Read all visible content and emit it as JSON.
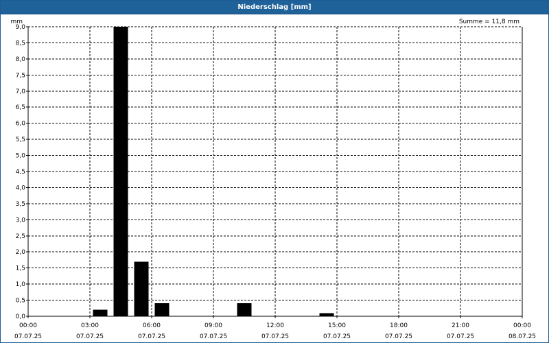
{
  "window": {
    "title": "Niederschlag [mm]"
  },
  "chart_data": {
    "type": "bar",
    "title": "Niederschlag [mm]",
    "ylabel": "mm",
    "xlabel": "",
    "ylim": [
      0,
      9.0
    ],
    "y_ticks": [
      0,
      0.5,
      1.0,
      1.5,
      2.0,
      2.5,
      3.0,
      3.5,
      4.0,
      4.5,
      5.0,
      5.5,
      6.0,
      6.5,
      7.0,
      7.5,
      8.0,
      8.5,
      9.0
    ],
    "y_tick_labels": [
      "0,0",
      "0,5",
      "1,0",
      "1,5",
      "2,0",
      "2,5",
      "3,0",
      "3,5",
      "4,0",
      "4,5",
      "5,0",
      "5,5",
      "6,0",
      "6,5",
      "7,0",
      "7,5",
      "8,0",
      "8,5",
      "9,0"
    ],
    "xlim": [
      "2025-07-07 00:00",
      "2025-07-08 00:00"
    ],
    "x_ticks": [
      {
        "time": "00:00",
        "date": "07.07.25"
      },
      {
        "time": "03:00",
        "date": "07.07.25"
      },
      {
        "time": "06:00",
        "date": "07.07.25"
      },
      {
        "time": "09:00",
        "date": "07.07.25"
      },
      {
        "time": "12:00",
        "date": "07.07.25"
      },
      {
        "time": "15:00",
        "date": "07.07.25"
      },
      {
        "time": "18:00",
        "date": "07.07.25"
      },
      {
        "time": "21:00",
        "date": "07.07.25"
      },
      {
        "time": "00:00",
        "date": "08.07.25"
      }
    ],
    "bars": [
      {
        "start": "2025-07-07 03:00",
        "end": "2025-07-07 04:00",
        "value": 0.2
      },
      {
        "start": "2025-07-07 04:00",
        "end": "2025-07-07 05:00",
        "value": 9.0
      },
      {
        "start": "2025-07-07 05:00",
        "end": "2025-07-07 06:00",
        "value": 1.7
      },
      {
        "start": "2025-07-07 06:00",
        "end": "2025-07-07 07:00",
        "value": 0.4
      },
      {
        "start": "2025-07-07 10:00",
        "end": "2025-07-07 11:00",
        "value": 0.4
      },
      {
        "start": "2025-07-07 14:00",
        "end": "2025-07-07 15:00",
        "value": 0.1
      }
    ],
    "annotation": "Summe = 11,8 mm",
    "grid": true,
    "colors": {
      "bar": "#000000",
      "grid": "#000000",
      "titlebar": "#1f6199"
    }
  }
}
